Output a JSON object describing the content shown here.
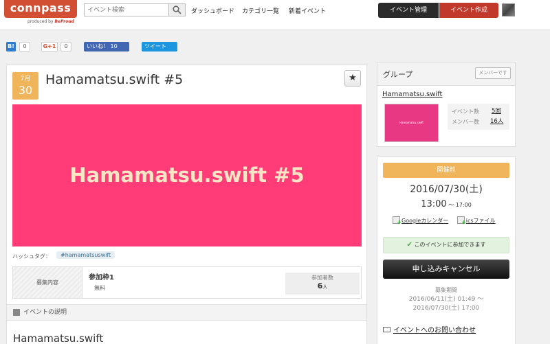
{
  "header": {
    "logo_text": "connpass",
    "logo_sub": "produced by",
    "logo_brand": "BeProud",
    "search_placeholder": "イベント検索",
    "nav": [
      "ダッシュボード",
      "カテゴリ一覧",
      "新着イベント"
    ],
    "manage_label": "イベント管理",
    "create_label": "イベント作成"
  },
  "social": {
    "hatena_label": "B!",
    "hatena_count": "0",
    "gplus_label": "G+1",
    "gplus_count": "0",
    "fb_label": "いいね！ 10",
    "tweet_label": "ツイート"
  },
  "event": {
    "month": "7月",
    "day": "30",
    "title": "Hamamatsu.swift #5",
    "banner_text": "Hamamatsu.swift #5",
    "hashtag_label": "ハッシュタグ：",
    "hashtag": "#hamamatsuswift",
    "recruit_label": "募集内容",
    "slot_name": "参加枠1",
    "slot_fee": "無料",
    "attendees_label": "参加者数",
    "attendees_count": "6",
    "attendees_unit": "人",
    "desc_header": "イベントの説明",
    "desc_title": "Hamamatsu.swift"
  },
  "group": {
    "header": "グループ",
    "member_button": "メンバーです",
    "name": "Hamamatsu.swift",
    "thumb_text": "Hamamatsu.swift",
    "events_label": "イベント数",
    "events_value": "5回",
    "members_label": "メンバー数",
    "members_value": "16人"
  },
  "panel": {
    "status": "開催前",
    "date": "2016/07/30(土)",
    "time_start": "13:00",
    "time_sep": " ～ ",
    "time_end": "17:00",
    "google_cal": "Googleカレンダー",
    "ics": "icsファイル",
    "can_join": "このイベントに参加できます",
    "cancel_button": "申し込みキャンセル",
    "period_label": "募集期間",
    "period_start": "2016/06/11(土) 01:49 ～",
    "period_end": "2016/07/30(土) 17:00",
    "contact": "イベントへのお問い合わせ"
  },
  "colors": {
    "brand": "#d34f33",
    "accent_orange": "#f0b45a",
    "banner_pink": "#ff3c77",
    "create_red": "#c0392b"
  }
}
